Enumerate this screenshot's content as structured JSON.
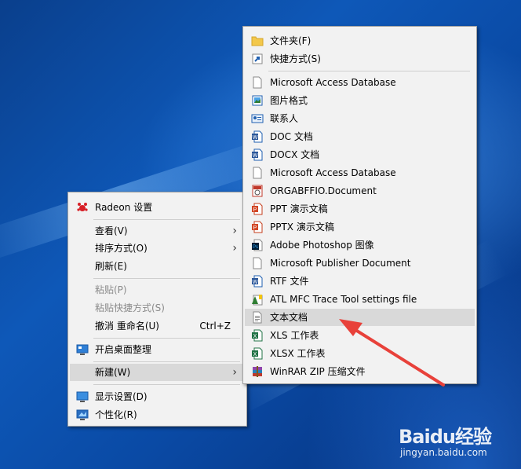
{
  "context_menu": {
    "items": [
      {
        "label": "Radeon 设置",
        "icon": "radeon-icon"
      },
      {
        "label": "查看(V)",
        "submenu": true
      },
      {
        "label": "排序方式(O)",
        "submenu": true
      },
      {
        "label": "刷新(E)"
      },
      {
        "label": "粘贴(P)",
        "disabled": true
      },
      {
        "label": "粘贴快捷方式(S)",
        "disabled": true
      },
      {
        "label": "撤消 重命名(U)",
        "shortcut": "Ctrl+Z"
      },
      {
        "label": "开启桌面整理",
        "icon": "desktop-organize-icon"
      },
      {
        "label": "新建(W)",
        "submenu": true,
        "highlight": true
      },
      {
        "label": "显示设置(D)",
        "icon": "display-settings-icon"
      },
      {
        "label": "个性化(R)",
        "icon": "personalize-icon"
      }
    ]
  },
  "new_submenu": {
    "items": [
      {
        "label": "文件夹(F)",
        "icon": "folder-icon"
      },
      {
        "label": "快捷方式(S)",
        "icon": "shortcut-icon"
      },
      {
        "label": "Microsoft Access Database",
        "icon": "blank-file-icon"
      },
      {
        "label": "图片格式",
        "icon": "image-file-icon"
      },
      {
        "label": "联系人",
        "icon": "contact-icon"
      },
      {
        "label": "DOC 文档",
        "icon": "doc-icon"
      },
      {
        "label": "DOCX 文档",
        "icon": "docx-icon"
      },
      {
        "label": "Microsoft Access Database",
        "icon": "blank-file-icon"
      },
      {
        "label": "ORGABFFIO.Document",
        "icon": "org-document-icon"
      },
      {
        "label": "PPT 演示文稿",
        "icon": "ppt-icon"
      },
      {
        "label": "PPTX 演示文稿",
        "icon": "pptx-icon"
      },
      {
        "label": "Adobe Photoshop 图像",
        "icon": "photoshop-icon"
      },
      {
        "label": "Microsoft Publisher Document",
        "icon": "blank-file-icon"
      },
      {
        "label": "RTF 文件",
        "icon": "rtf-icon"
      },
      {
        "label": "ATL MFC Trace Tool settings file",
        "icon": "atl-trace-icon"
      },
      {
        "label": "文本文档",
        "icon": "text-document-icon",
        "highlight": true
      },
      {
        "label": "XLS 工作表",
        "icon": "xls-icon"
      },
      {
        "label": "XLSX 工作表",
        "icon": "xlsx-icon"
      },
      {
        "label": "WinRAR ZIP 压缩文件",
        "icon": "winrar-zip-icon"
      }
    ]
  },
  "watermark": {
    "brand": "Baidu经验",
    "site": "jingyan.baidu.com"
  },
  "colors": {
    "menu_bg": "#f2f2f2",
    "highlight": "#d9d9d9",
    "desktop": "#0e58b8",
    "arrow": "#e8413a"
  }
}
